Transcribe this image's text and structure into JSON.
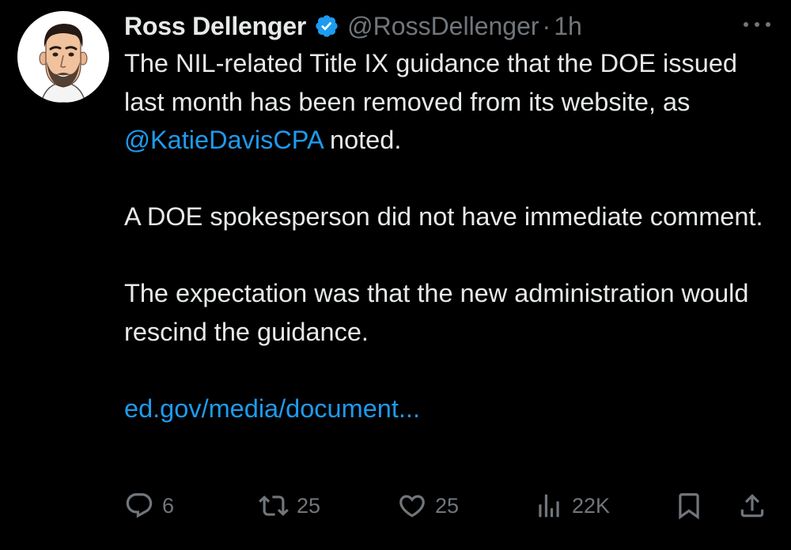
{
  "author": {
    "name": "Ross Dellenger",
    "handle": "@RossDellenger",
    "separator": "·",
    "time": "1h"
  },
  "tweet": {
    "p1_before": "The NIL-related Title IX guidance that the DOE issued last month has been removed from its website, as ",
    "p1_mention": "@KatieDavisCPA",
    "p1_after": " noted.",
    "p2": "A DOE spokesperson did not have immediate comment.",
    "p3": "The expectation was that the new administration would rescind the guidance.",
    "link": "ed.gov/media/document..."
  },
  "stats": {
    "replies": "6",
    "reposts": "25",
    "likes": "25",
    "views": "22K"
  },
  "colors": {
    "background": "#000000",
    "text": "#e7e9ea",
    "muted": "#71767b",
    "accent": "#1d9bf0"
  },
  "icons": {
    "verified": "verified-badge-icon",
    "more": "more-options-icon",
    "reply": "reply-icon",
    "repost": "repost-icon",
    "like": "heart-icon",
    "views": "views-icon",
    "bookmark": "bookmark-icon",
    "share": "share-icon"
  }
}
